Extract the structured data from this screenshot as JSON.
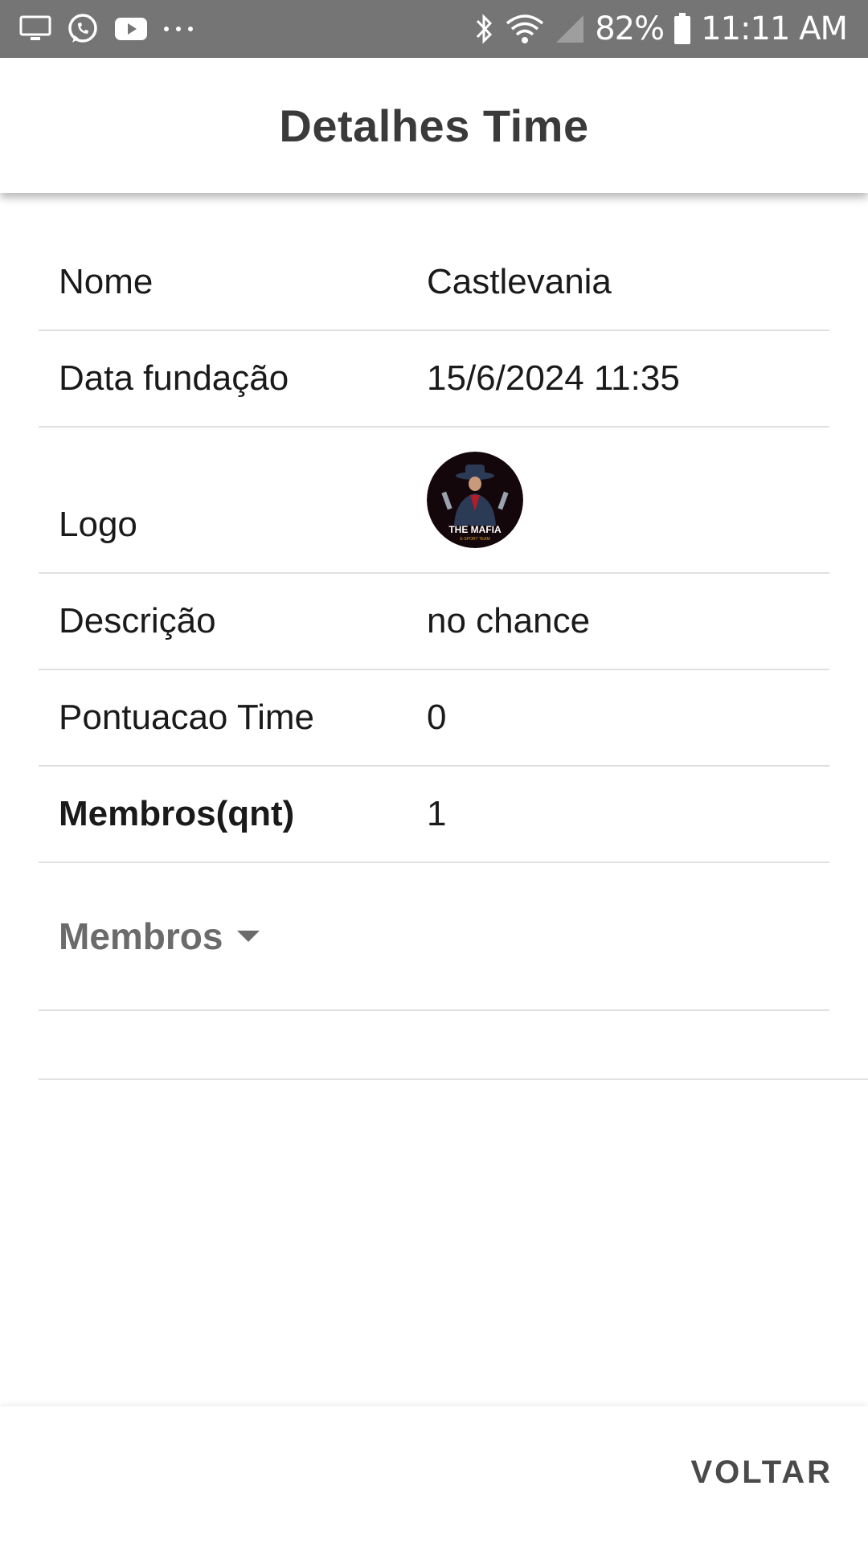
{
  "status_bar": {
    "battery": "82%",
    "time": "11:11 AM",
    "left_icons": [
      "screen-cast-icon",
      "whatsapp-icon",
      "youtube-icon",
      "more-dots-icon"
    ],
    "right_icons": [
      "bluetooth-icon",
      "wifi-icon",
      "signal-icon",
      "battery-icon"
    ],
    "background": "#757575"
  },
  "app_bar": {
    "title": "Detalhes Time"
  },
  "details": {
    "nome_label": "Nome",
    "nome_value": "Castlevania",
    "data_label": "Data fundação",
    "data_value": "15/6/2024 11:35",
    "logo_label": "Logo",
    "logo_text": "THE MAFIA",
    "logo_subtext": "E-SPORT TEAM",
    "descricao_label": "Descrição",
    "descricao_value": "no chance",
    "pontuacao_label": "Pontuacao Time",
    "pontuacao_value": "0",
    "membros_qnt_label": "Membros(qnt)",
    "membros_qnt_value": "1"
  },
  "membros": {
    "label": "Membros"
  },
  "footer": {
    "back_label": "VOLTAR"
  }
}
